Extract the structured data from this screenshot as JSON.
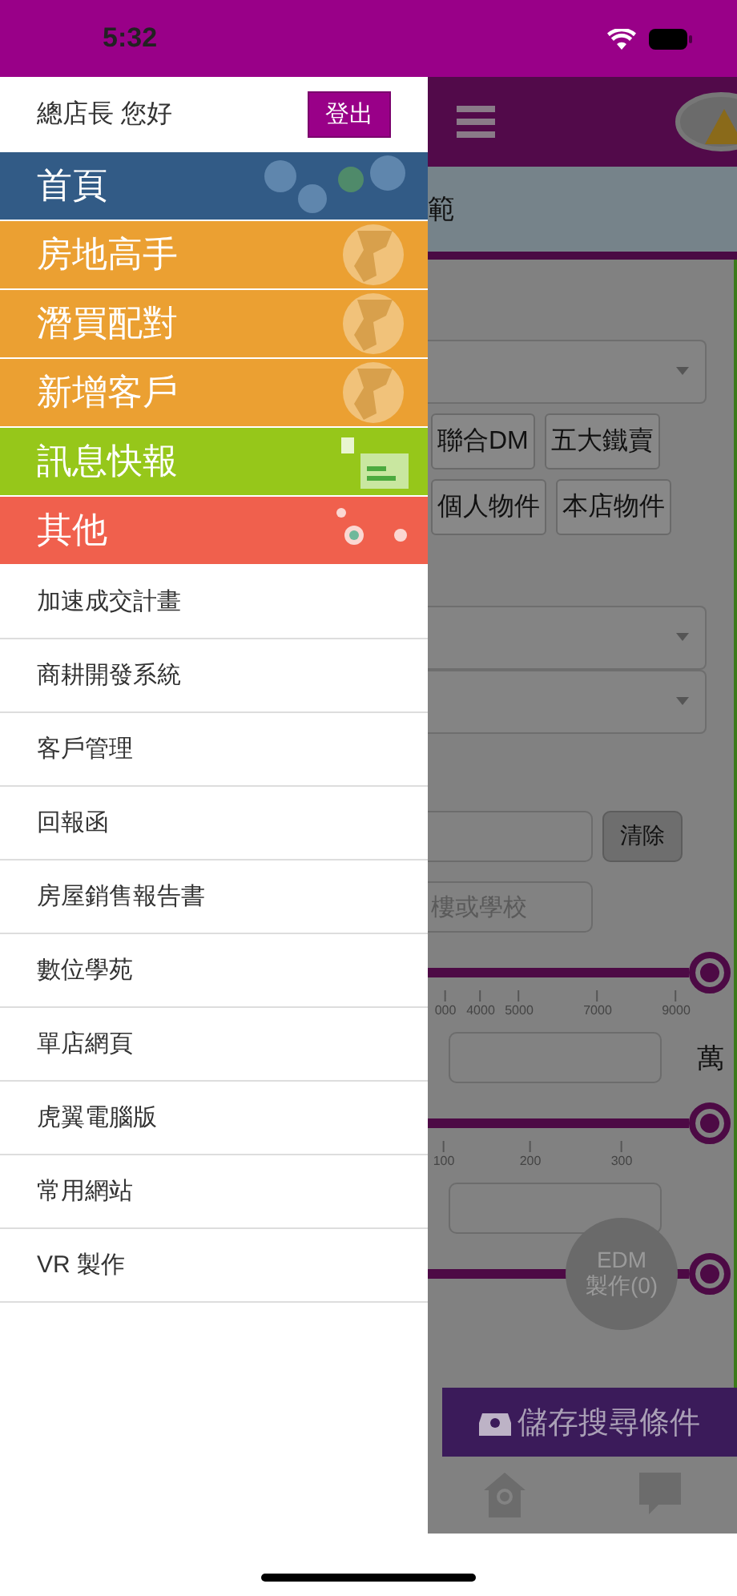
{
  "status_bar": {
    "time": "5:32"
  },
  "drawer": {
    "greeting": "總店長 您好",
    "logout": "登出",
    "main_items": [
      {
        "label": "首頁",
        "color": "#325b86",
        "kind": "gears"
      },
      {
        "label": "房地高手",
        "color": "#eba032",
        "kind": "globe"
      },
      {
        "label": "潛買配對",
        "color": "#eba032",
        "kind": "globe"
      },
      {
        "label": "新增客戶",
        "color": "#eba032",
        "kind": "globe"
      },
      {
        "label": "訊息快報",
        "color": "#96c71a",
        "kind": "news"
      },
      {
        "label": "其他",
        "color": "#f0604d",
        "kind": "dots"
      }
    ],
    "items": [
      "加速成交計畫",
      "商耕開發系統",
      "客戶管理",
      "回報函",
      "房屋銷售報告書",
      "數位學苑",
      "單店網頁",
      "虎翼電腦版",
      "常用網站",
      "VR 製作"
    ]
  },
  "background_page": {
    "banner_text": "範",
    "tag_rows": [
      [
        "聯合DM",
        "五大鐵賣"
      ],
      [
        "個人物件",
        "本店物件"
      ]
    ],
    "clear_button": "清除",
    "keyword_placeholder": "樓或學校",
    "sliders": [
      {
        "level": 1,
        "ticks": [
          "000",
          "4000",
          "5000",
          "7000",
          "9000"
        ],
        "unit": "萬"
      },
      {
        "level": 1,
        "ticks": [
          "100",
          "200",
          "300"
        ]
      },
      {
        "level": 1
      }
    ],
    "edm_button": [
      "EDM",
      "製作(0)"
    ],
    "save_button": "儲存搜尋條件"
  }
}
